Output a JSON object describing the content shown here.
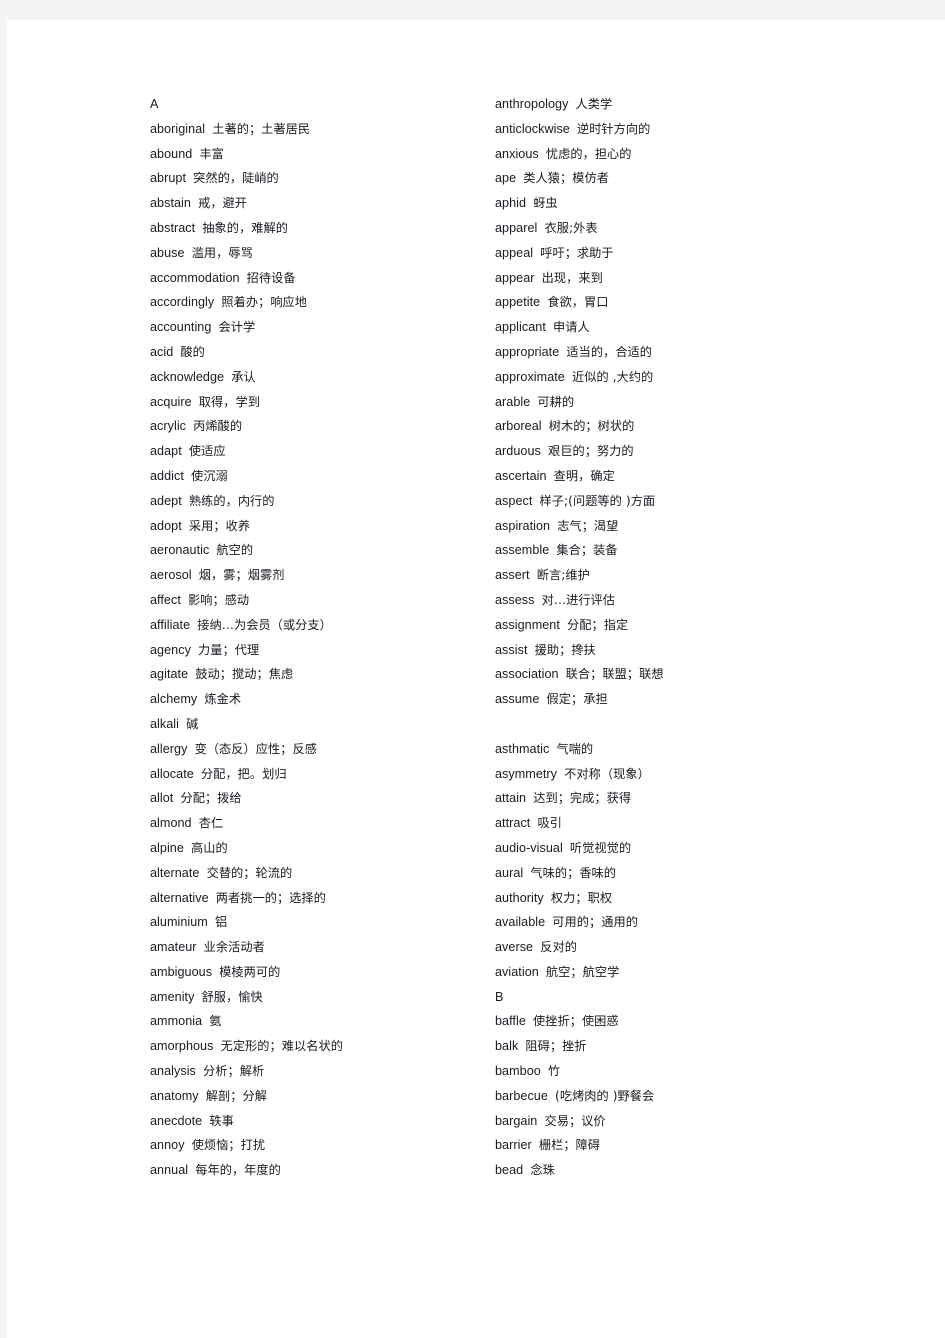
{
  "page": {
    "background_color": "#f4f4f4",
    "paper_color": "#ffffff",
    "text_color": "#1a1a22"
  },
  "columns": [
    {
      "name": "left-column",
      "entries": [
        {
          "word": "A",
          "gloss": ""
        },
        {
          "word": "aboriginal",
          "gloss": "土著的；土著居民"
        },
        {
          "word": "abound",
          "gloss": "丰富"
        },
        {
          "word": "abrupt",
          "gloss": "突然的，陡峭的"
        },
        {
          "word": "abstain",
          "gloss": "戒，避开"
        },
        {
          "word": "abstract",
          "gloss": "抽象的，难解的"
        },
        {
          "word": "abuse",
          "gloss": "滥用，辱骂"
        },
        {
          "word": "accommodation",
          "gloss": "招待设备"
        },
        {
          "word": "accordingly",
          "gloss": "照着办；响应地"
        },
        {
          "word": "accounting",
          "gloss": "会计学"
        },
        {
          "word": "acid",
          "gloss": "酸的"
        },
        {
          "word": "acknowledge",
          "gloss": "承认"
        },
        {
          "word": "acquire",
          "gloss": "取得，学到"
        },
        {
          "word": "acrylic",
          "gloss": "丙烯酸的"
        },
        {
          "word": "adapt",
          "gloss": "使适应"
        },
        {
          "word": "addict",
          "gloss": "使沉溺"
        },
        {
          "word": "adept",
          "gloss": "熟练的，内行的"
        },
        {
          "word": "adopt",
          "gloss": "采用；收养"
        },
        {
          "word": "aeronautic",
          "gloss": "航空的"
        },
        {
          "word": "aerosol",
          "gloss": "烟，雾；烟雾剂"
        },
        {
          "word": "affect",
          "gloss": "影响；感动"
        },
        {
          "word": "affiliate",
          "gloss": "接纳…为会员（或分支）"
        },
        {
          "word": "agency",
          "gloss": "力量；代理"
        },
        {
          "word": "agitate",
          "gloss": "鼓动；搅动；焦虑"
        },
        {
          "word": "alchemy",
          "gloss": "炼金术"
        },
        {
          "word": "alkali",
          "gloss": "碱"
        },
        {
          "word": "allergy",
          "gloss": "变（态反）应性；反感"
        },
        {
          "word": "allocate",
          "gloss": "分配，把。划归"
        },
        {
          "word": "allot",
          "gloss": "分配；拨给"
        },
        {
          "word": "almond",
          "gloss": "杏仁"
        },
        {
          "word": "alpine",
          "gloss": "高山的"
        },
        {
          "word": "alternate",
          "gloss": "交替的；轮流的"
        },
        {
          "word": "alternative",
          "gloss": "两者挑一的；选择的"
        },
        {
          "word": "aluminium",
          "gloss": "铝"
        },
        {
          "word": "amateur",
          "gloss": "业余活动者"
        },
        {
          "word": "ambiguous",
          "gloss": "模棱两可的"
        },
        {
          "word": "amenity",
          "gloss": "舒服，愉快"
        },
        {
          "word": "ammonia",
          "gloss": "氨"
        },
        {
          "word": "amorphous",
          "gloss": "无定形的；难以名状的"
        },
        {
          "word": "analysis",
          "gloss": "分析；解析"
        },
        {
          "word": "anatomy",
          "gloss": "解剖；分解"
        },
        {
          "word": "anecdote",
          "gloss": "轶事"
        },
        {
          "word": "annoy",
          "gloss": "使烦恼；打扰"
        },
        {
          "word": "annual",
          "gloss": "每年的，年度的"
        }
      ]
    },
    {
      "name": "right-column",
      "entries": [
        {
          "word": "anthropology",
          "gloss": "人类学"
        },
        {
          "word": "anticlockwise",
          "gloss": "逆时针方向的"
        },
        {
          "word": "anxious",
          "gloss": "忧虑的，担心的"
        },
        {
          "word": "ape",
          "gloss": "类人猿；模仿者"
        },
        {
          "word": "aphid",
          "gloss": "蚜虫"
        },
        {
          "word": "apparel",
          "gloss": "衣服;外表"
        },
        {
          "word": "appeal",
          "gloss": "呼吁；求助于"
        },
        {
          "word": "appear",
          "gloss": "出现，来到"
        },
        {
          "word": "appetite",
          "gloss": "食欲，胃口"
        },
        {
          "word": "applicant",
          "gloss": "申请人"
        },
        {
          "word": "appropriate",
          "gloss": "适当的，合适的"
        },
        {
          "word": "approximate",
          "gloss": "近似的 ,大约的"
        },
        {
          "word": "arable",
          "gloss": "可耕的"
        },
        {
          "word": "arboreal",
          "gloss": "树木的；树状的"
        },
        {
          "word": "arduous",
          "gloss": "艰巨的；努力的"
        },
        {
          "word": "ascertain",
          "gloss": "查明，确定"
        },
        {
          "word": "aspect",
          "gloss": "样子;(问题等的 )方面"
        },
        {
          "word": "aspiration",
          "gloss": "志气；渴望"
        },
        {
          "word": "assemble",
          "gloss": "集合；装备"
        },
        {
          "word": "assert",
          "gloss": "断言;维护"
        },
        {
          "word": "assess",
          "gloss": "对…进行评估"
        },
        {
          "word": "assignment",
          "gloss": "分配；指定"
        },
        {
          "word": "assist",
          "gloss": "援助；搀扶"
        },
        {
          "word": "association",
          "gloss": "联合；联盟；联想"
        },
        {
          "word": "assume",
          "gloss": "假定；承担"
        },
        {
          "word": "",
          "gloss": ""
        },
        {
          "word": "asthmatic",
          "gloss": "气喘的"
        },
        {
          "word": "asymmetry",
          "gloss": "不对称（现象）"
        },
        {
          "word": "attain",
          "gloss": "达到；完成；获得"
        },
        {
          "word": "attract",
          "gloss": "吸引"
        },
        {
          "word": "audio-visual",
          "gloss": "听觉视觉的"
        },
        {
          "word": "aural",
          "gloss": "气味的；香味的"
        },
        {
          "word": "authority",
          "gloss": "权力；职权"
        },
        {
          "word": "available",
          "gloss": "可用的；通用的"
        },
        {
          "word": "averse",
          "gloss": "反对的"
        },
        {
          "word": "aviation",
          "gloss": "航空；航空学"
        },
        {
          "word": "B",
          "gloss": ""
        },
        {
          "word": "baffle",
          "gloss": "使挫折；使困惑"
        },
        {
          "word": "balk",
          "gloss": "阻碍；挫折"
        },
        {
          "word": "bamboo",
          "gloss": "竹"
        },
        {
          "word": "barbecue",
          "gloss": "(吃烤肉的 )野餐会"
        },
        {
          "word": "bargain",
          "gloss": "交易；议价"
        },
        {
          "word": "barrier",
          "gloss": "栅栏；障碍"
        },
        {
          "word": "bead",
          "gloss": "念珠"
        }
      ]
    }
  ]
}
